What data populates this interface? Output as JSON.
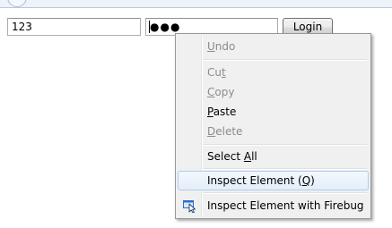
{
  "form": {
    "username_value": "123",
    "password_value": "●●●",
    "login_label": "Login"
  },
  "context_menu": {
    "items": [
      {
        "pre": "",
        "key": "U",
        "post": "ndo",
        "disabled": true
      },
      {
        "pre": "Cu",
        "key": "t",
        "post": "",
        "disabled": true
      },
      {
        "pre": "",
        "key": "C",
        "post": "opy",
        "disabled": true
      },
      {
        "pre": "",
        "key": "P",
        "post": "aste",
        "disabled": false
      },
      {
        "pre": "",
        "key": "D",
        "post": "elete",
        "disabled": true
      },
      {
        "pre": "Select ",
        "key": "A",
        "post": "ll",
        "disabled": false
      },
      {
        "pre": "Inspect Element (",
        "key": "Q",
        "post": ")",
        "disabled": false,
        "highlighted": true
      },
      {
        "pre": "Inspect Element with Firebug",
        "key": "",
        "post": "",
        "disabled": false,
        "icon": "firebug-inspect-icon"
      }
    ]
  },
  "colors": {
    "menu_bg": "#f0f0f0",
    "disabled_text": "#8c8c8c",
    "highlight_border": "#aeccef",
    "firebug_blue": "#2a6fc9"
  }
}
